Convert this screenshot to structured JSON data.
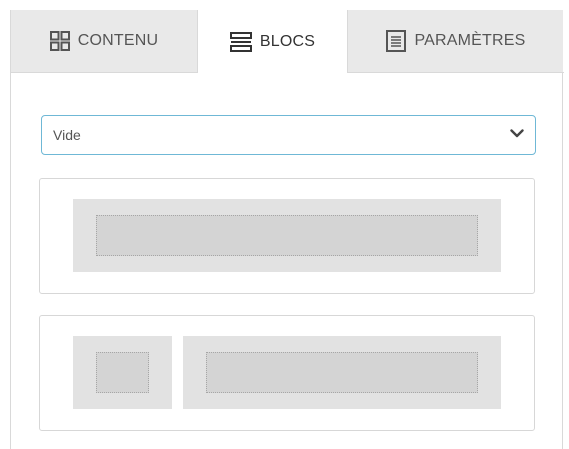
{
  "tabs": [
    {
      "label": "CONTENU",
      "icon": "grid-icon",
      "active": false
    },
    {
      "label": "BLOCS",
      "icon": "layers-icon",
      "active": true
    },
    {
      "label": "PARAMÈTRES",
      "icon": "document-icon",
      "active": false
    }
  ],
  "select": {
    "value": "Vide",
    "icon": "chevron-down-icon"
  },
  "layouts": [
    {
      "name": "single-column-layout",
      "columns": 1
    },
    {
      "name": "two-column-layout",
      "columns": 2
    }
  ],
  "colors": {
    "tab_bar": "#e9e9e9",
    "active_tab": "#ffffff",
    "select_border": "#6fb8d6",
    "block_outer": "#e2e2e2",
    "block_inner": "#d4d4d4"
  }
}
